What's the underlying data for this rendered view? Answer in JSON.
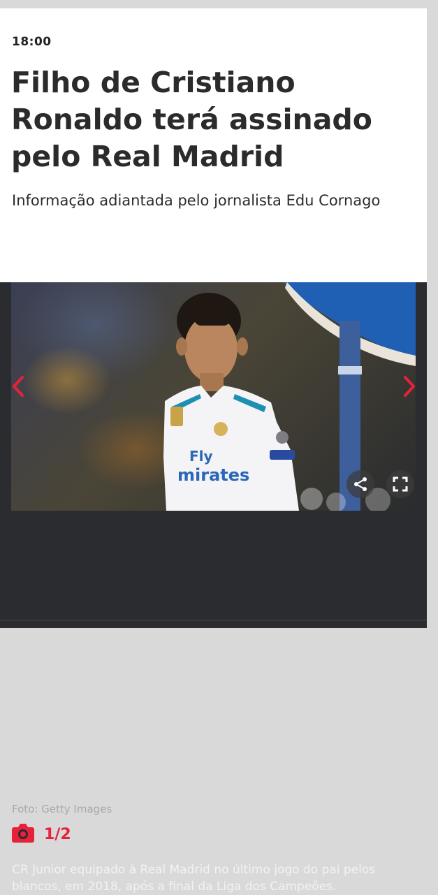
{
  "article": {
    "time": "18:00",
    "headline": "Filho de Cristiano Ronaldo terá assinado pelo Real Madrid",
    "subtitle": "Informação adiantada pelo jornalista Edu Cornago"
  },
  "gallery": {
    "photo_credit": "Foto: Getty Images",
    "counter": "1/2",
    "caption": "CR Junior equipado à Real Madrid no último jogo do pai pelos blancos, em 2018, após a final da Liga dos Campeões.",
    "jersey_text_line1": "Fly",
    "jersey_text_line2": "mirates",
    "icons": {
      "prev": "chevron-left-icon",
      "next": "chevron-right-icon",
      "share": "share-icon",
      "fullscreen": "fullscreen-icon",
      "camera": "camera-icon"
    },
    "colors": {
      "accent": "#e8213a",
      "gallery_bg": "#2a2c30"
    }
  }
}
